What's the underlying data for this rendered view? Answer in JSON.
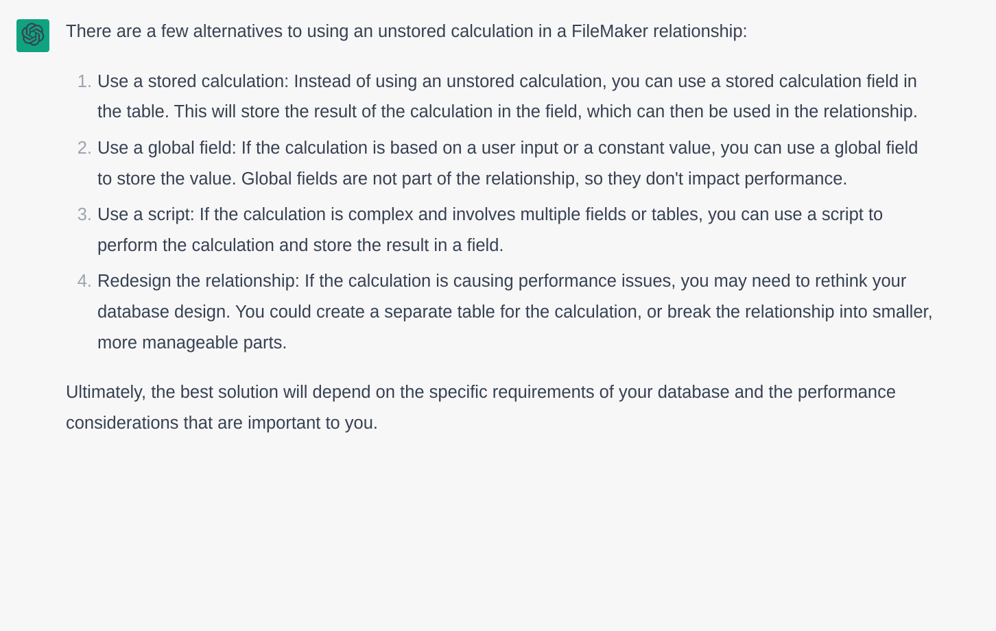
{
  "message": {
    "intro": "There are a few alternatives to using an unstored calculation in a FileMaker relationship:",
    "items": [
      "Use a stored calculation: Instead of using an unstored calculation, you can use a stored calculation field in the table. This will store the result of the calculation in the field, which can then be used in the relationship.",
      "Use a global field: If the calculation is based on a user input or a constant value, you can use a global field to store the value. Global fields are not part of the relationship, so they don't impact performance.",
      "Use a script: If the calculation is complex and involves multiple fields or tables, you can use a script to perform the calculation and store the result in a field.",
      "Redesign the relationship: If the calculation is causing performance issues, you may need to rethink your database design. You could create a separate table for the calculation, or break the relationship into smaller, more manageable parts."
    ],
    "conclusion": "Ultimately, the best solution will depend on the specific requirements of your database and the performance considerations that are important to you."
  }
}
